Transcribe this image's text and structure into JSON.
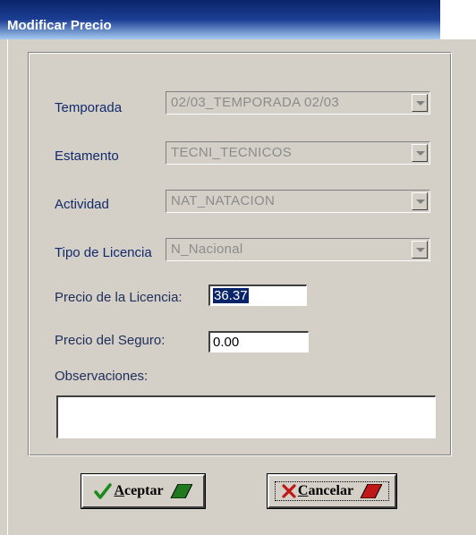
{
  "window": {
    "title": "Modificar Precio"
  },
  "form": {
    "temporada": {
      "label": "Temporada",
      "value": "02/03_TEMPORADA 02/03"
    },
    "estamento": {
      "label": "Estamento",
      "value": "TECNI_TECNICOS"
    },
    "actividad": {
      "label": "Actividad",
      "value": "NAT_NATACION"
    },
    "tipo_licencia": {
      "label": "Tipo de Licencia",
      "value": "N_Nacional"
    },
    "precio_licencia": {
      "label": "Precio de la Licencia:",
      "value": "36.37"
    },
    "precio_seguro": {
      "label": "Precio del Seguro:",
      "value": "0.00"
    },
    "observaciones": {
      "label": "Observaciones:",
      "value": ""
    }
  },
  "buttons": {
    "aceptar": {
      "label_rest": "ceptar",
      "mnemonic": "A"
    },
    "cancelar": {
      "label_rest": "ancelar",
      "mnemonic": "C"
    }
  },
  "colors": {
    "title_bar": "#0a246a",
    "label_text": "#102a6b",
    "check_green": "#1a8a1a",
    "accept_green": "#1f7a1f",
    "cancel_red": "#c01818"
  }
}
